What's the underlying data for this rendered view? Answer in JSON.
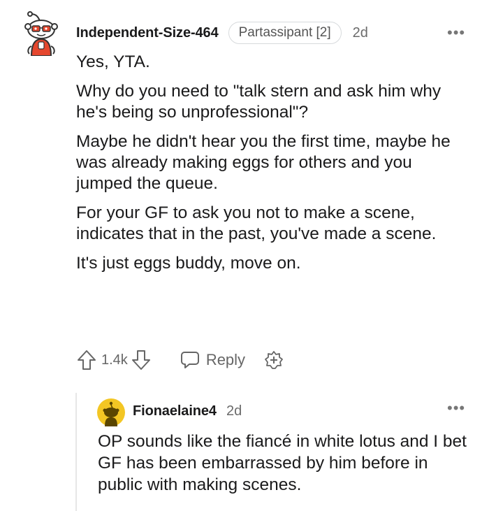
{
  "main_comment": {
    "username": "Independent-Size-464",
    "flair": "Partassipant [2]",
    "age": "2d",
    "more": "•••",
    "paragraphs": [
      "Yes, YTA.",
      "Why do you need to \"talk stern and ask him why he's being so unprofessional\"?",
      "Maybe he didn't hear you the first time, maybe he was already making eggs for others and you jumped the queue.",
      "For your GF to ask you not to make a scene, indicates that in the past, you've made a scene.",
      "It's just eggs buddy, move on."
    ],
    "vote_count": "1.4k",
    "reply_label": "Reply"
  },
  "reply_comment": {
    "username": "Fionaelaine4",
    "age": "2d",
    "more": "•••",
    "body": "OP sounds like the fiancé in white lotus and I bet GF has been embarrassed by him before in public with making scenes."
  },
  "icons": {
    "upvote": "arrow-up-icon",
    "downvote": "arrow-down-icon",
    "reply": "speech-bubble-icon",
    "award": "award-plus-icon"
  },
  "colors": {
    "text": "#1a1a1b",
    "meta": "#6b6b6b",
    "avatar_red": "#e5472e",
    "avatar_yellow": "#f3c624"
  }
}
